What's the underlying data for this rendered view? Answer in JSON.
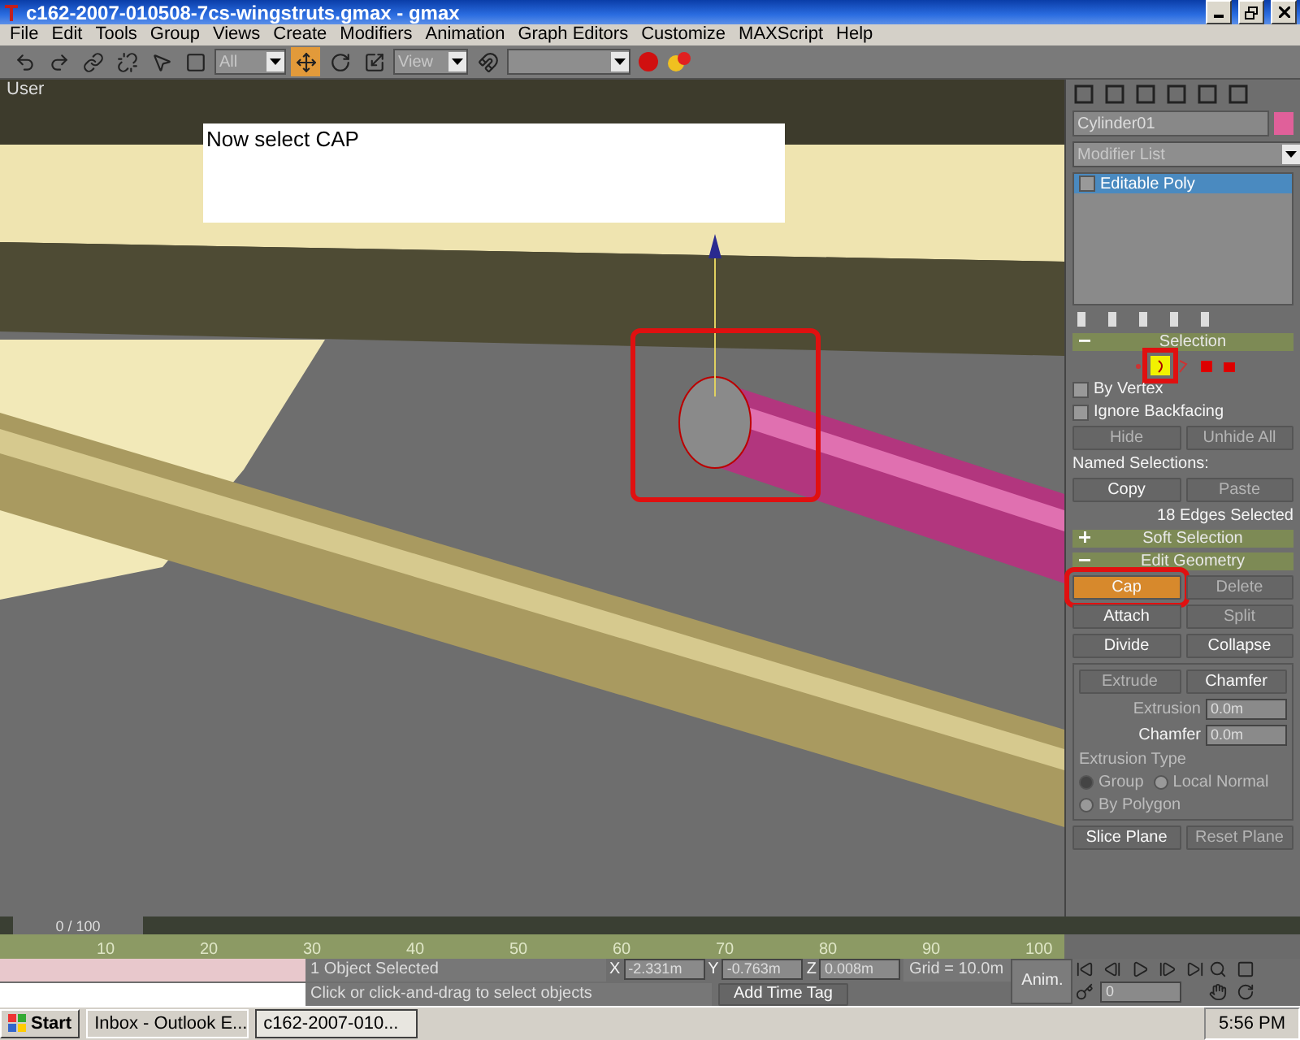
{
  "window": {
    "title": "c162-2007-010508-7cs-wingstruts.gmax - gmax"
  },
  "menu": [
    "File",
    "Edit",
    "Tools",
    "Group",
    "Views",
    "Create",
    "Modifiers",
    "Animation",
    "Graph Editors",
    "Customize",
    "MAXScript",
    "Help"
  ],
  "toolbar": {
    "selection_filter": "All",
    "reference_coord": "View"
  },
  "viewport": {
    "label": "User",
    "note": "Now select CAP"
  },
  "command_panel": {
    "object_name": "Cylinder01",
    "modifier_list": "Modifier List",
    "stack": [
      {
        "label": "Editable Poly",
        "selected": true
      }
    ],
    "selection": {
      "title": "Selection",
      "expanded": true,
      "subobjects": [
        {
          "kind": "vertex",
          "selected": false
        },
        {
          "kind": "edge",
          "selected": true
        },
        {
          "kind": "border",
          "selected": false
        },
        {
          "kind": "polygon",
          "selected": false
        },
        {
          "kind": "element",
          "selected": false
        }
      ],
      "checks": [
        {
          "label": "By Vertex",
          "checked": false
        },
        {
          "label": "Ignore Backfacing",
          "checked": false
        }
      ],
      "buttons": [
        {
          "label": "Hide",
          "disabled": true
        },
        {
          "label": "Unhide All",
          "disabled": true
        }
      ],
      "named_label": "Named Selections:",
      "named_buttons": [
        {
          "label": "Copy",
          "disabled": false
        },
        {
          "label": "Paste",
          "disabled": true
        }
      ],
      "status": "18 Edges Selected"
    },
    "soft_selection": {
      "title": "Soft Selection",
      "expanded": false
    },
    "edit_geometry": {
      "title": "Edit Geometry",
      "expanded": true,
      "buttons": [
        {
          "label": "Cap",
          "disabled": false,
          "selected": true
        },
        {
          "label": "Delete",
          "disabled": true,
          "selected": false
        },
        {
          "label": "Attach",
          "disabled": false,
          "selected": false
        },
        {
          "label": "Split",
          "disabled": true,
          "selected": false
        },
        {
          "label": "Divide",
          "disabled": false,
          "selected": false
        },
        {
          "label": "Collapse",
          "disabled": false,
          "selected": false
        }
      ],
      "extrude_buttons": [
        {
          "label": "Extrude",
          "disabled": true
        },
        {
          "label": "Chamfer",
          "disabled": false
        }
      ],
      "spinners": [
        {
          "label": "Extrusion",
          "value": "0.0m",
          "disabled": true
        },
        {
          "label": "Chamfer",
          "value": "0.0m",
          "disabled": false
        }
      ],
      "extrusion_type": {
        "label": "Extrusion Type",
        "options": [
          {
            "label": "Group",
            "selected": true
          },
          {
            "label": "Local Normal",
            "selected": false
          },
          {
            "label": "By Polygon",
            "selected": false
          }
        ]
      },
      "plane_buttons": [
        {
          "label": "Slice Plane",
          "disabled": false
        },
        {
          "label": "Reset Plane",
          "disabled": true
        }
      ]
    }
  },
  "timeline": {
    "frame": "0 / 100",
    "ticks": [
      "10",
      "20",
      "30",
      "40",
      "50",
      "60",
      "70",
      "80",
      "90",
      "100"
    ]
  },
  "status_bar": {
    "selected": "1 Object Selected",
    "prompt": "Click or click-and-drag to select objects",
    "x_label": "X",
    "x": "-2.331m",
    "y_label": "Y",
    "y": "-0.763m",
    "z_label": "Z",
    "z": "0.008m",
    "grid": "Grid = 10.0m",
    "time_tag": "Add Time Tag",
    "anim": "Anim.",
    "frame": "0"
  },
  "taskbar": {
    "start": "Start",
    "tasks": [
      {
        "label": "Inbox - Outlook E...",
        "selected": false
      },
      {
        "label": "c162-2007-010...",
        "selected": true
      }
    ],
    "clock": "5:56 PM"
  }
}
